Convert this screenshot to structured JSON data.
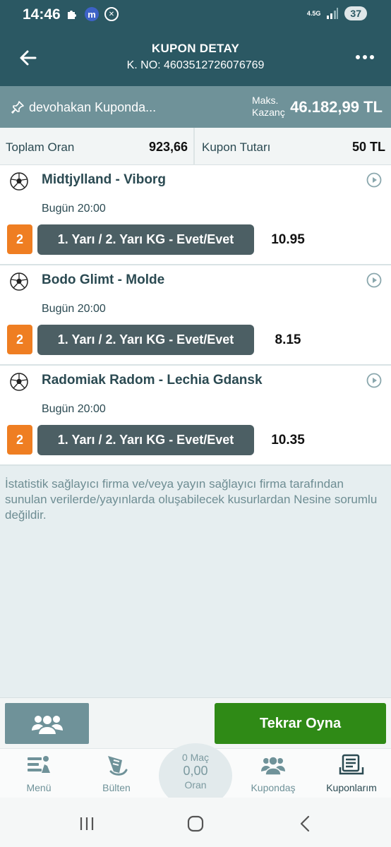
{
  "status_bar": {
    "time": "14:46",
    "network": "4.5G",
    "battery": "37"
  },
  "header": {
    "title": "KUPON DETAY",
    "coupon_no": "K. NO: 4603512726076769"
  },
  "info_bar": {
    "user_text": "devohakan Kuponda...",
    "maks_label_line1": "Maks.",
    "maks_label_line2": "Kazanç",
    "max_win": "46.182,99 TL"
  },
  "summary": {
    "total_odds_label": "Toplam Oran",
    "total_odds": "923,66",
    "stake_label": "Kupon Tutarı",
    "stake": "50 TL"
  },
  "matches": [
    {
      "teams": "Midtjylland - Viborg",
      "date": "Bugün 20:00",
      "badge": "2",
      "bet": "1. Yarı / 2. Yarı KG - Evet/Evet",
      "odd": "10.95"
    },
    {
      "teams": "Bodo Glimt - Molde",
      "date": "Bugün 20:00",
      "badge": "2",
      "bet": "1. Yarı / 2. Yarı KG - Evet/Evet",
      "odd": "8.15"
    },
    {
      "teams": "Radomiak Radom - Lechia Gdansk",
      "date": "Bugün 20:00",
      "badge": "2",
      "bet": "1. Yarı / 2. Yarı KG - Evet/Evet",
      "odd": "10.35"
    }
  ],
  "disclaimer": "İstatistik sağlayıcı firma ve/veya yayın sağlayıcı firma tarafından sunulan verilerde/yayınlarda oluşabilecek kusurlardan Nesine sorumlu değildir.",
  "actions": {
    "replay_label": "Tekrar Oyna"
  },
  "bottom_nav": {
    "menu": "Menü",
    "bulten": "Bülten",
    "mac_count": "0 Maç",
    "oran_value": "0,00",
    "oran_label": "Oran",
    "kuponda": "Kupondaş",
    "kuponlarim": "Kuponlarım"
  },
  "colors": {
    "header": "#2b5863",
    "info_bar": "#6f9299",
    "badge": "#ef7e22",
    "bet_button": "#4c5f64",
    "replay_button": "#2f8a16"
  },
  "icons": {
    "back": "arrow-left-icon",
    "more": "more-vertical-icon",
    "pin": "pin-icon",
    "sport": "soccer-ball-icon",
    "play": "play-circle-icon"
  }
}
